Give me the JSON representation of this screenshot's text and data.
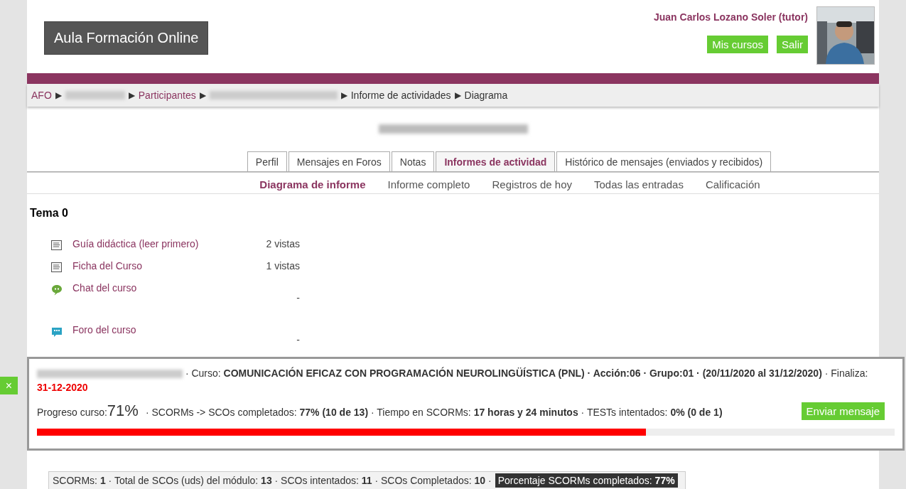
{
  "header": {
    "logo": "Aula Formación Online",
    "user": "Juan Carlos Lozano Soler (tutor)",
    "buttons": [
      "Mis cursos",
      "Salir"
    ]
  },
  "breadcrumb_separator": "▶",
  "breadcrumb": [
    {
      "kind": "link",
      "label": "AFO"
    },
    {
      "kind": "redacted"
    },
    {
      "kind": "link",
      "label": "Participantes"
    },
    {
      "kind": "redacted"
    },
    {
      "kind": "text",
      "label": "Informe de actividades"
    },
    {
      "kind": "text",
      "label": "Diagrama"
    }
  ],
  "page_title": {
    "kind": "redacted"
  },
  "tabs": [
    {
      "label": "Perfil",
      "selected": false
    },
    {
      "label": "Mensajes en Foros",
      "selected": false
    },
    {
      "label": "Notas",
      "selected": false
    },
    {
      "label": "Informes de actividad",
      "selected": true
    },
    {
      "label": "Histórico de mensajes (enviados y recibidos)",
      "selected": false
    }
  ],
  "subtabs": [
    {
      "label": "Diagrama de informe",
      "selected": true
    },
    {
      "label": "Informe completo",
      "selected": false
    },
    {
      "label": "Registros de hoy",
      "selected": false
    },
    {
      "label": "Todas las entradas",
      "selected": false
    },
    {
      "label": "Calificación",
      "selected": false
    }
  ],
  "section": {
    "title": "Tema 0",
    "activities": [
      {
        "kind": "page",
        "name": "Guía didáctica (leer primero)",
        "views": "2 vistas"
      },
      {
        "kind": "page",
        "name": "Ficha del Curso",
        "views": "1 vistas"
      },
      {
        "kind": "chat",
        "name": "Chat del curso",
        "views": "-"
      },
      {
        "kind": "forum",
        "name": "Foro del curso",
        "views": "-"
      }
    ]
  },
  "panel": {
    "close": "×",
    "course_line": "· Curso: **COMUNICACIÓN EFICAZ CON PROGRAMACIÓN NEUROLINGÜÍSTICA (PNL) · Acción:06 · Grupo:01 · (20/11/2020 al 31/12/2020)** · Finaliza:",
    "end_date": "31-12-2020",
    "progress_label": "Progreso curso:",
    "progress_value": "71%",
    "stats": "· SCORMs -> SCOs completados: **77% (10 de 13)** · Tiempo en SCORMs: **17 horas y 24 minutos** · TESTs intentados: **0% (0 de 1)**",
    "button": "Enviar mensaje",
    "level": 0.71
  },
  "summary": {
    "counts": "SCORMs: **1** · Total de SCOs (uds) del módulo: **13** · SCOs intentados: **11** · SCOs Completados: **10** ·",
    "percentage": "Porcentaje SCORMs completados: **77%**"
  }
}
